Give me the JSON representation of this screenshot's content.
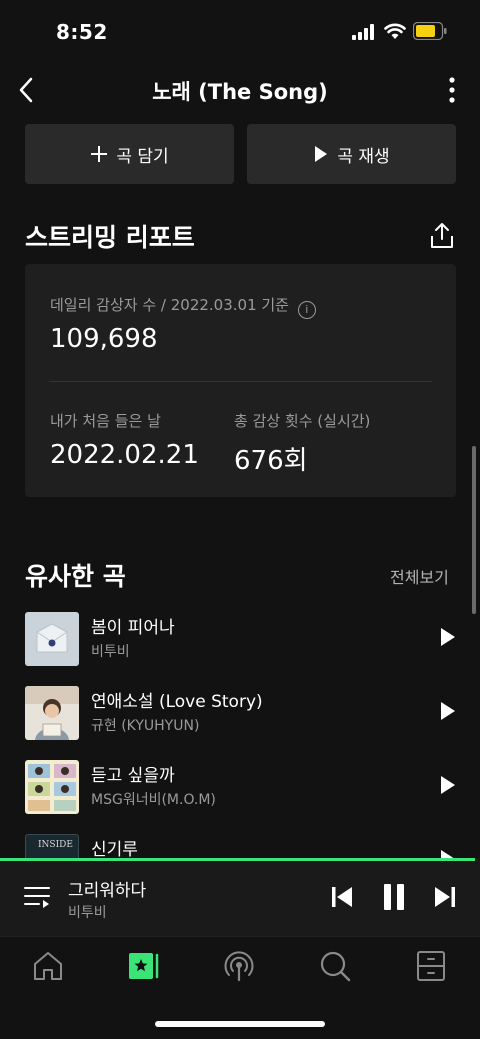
{
  "status": {
    "time": "8:52"
  },
  "header": {
    "title": "노래 (The Song)"
  },
  "actions": {
    "add_label": "곡 담기",
    "play_label": "곡 재생"
  },
  "report": {
    "title": "스트리밍 리포트",
    "daily_label": "데일리 감상자 수 / 2022.03.01 기준",
    "daily_value": "109,698",
    "first_heard_label": "내가 처음 들은 날",
    "first_heard_value": "2022.02.21",
    "total_plays_label": "총 감상 횟수 (실시간)",
    "total_plays_value": "676회"
  },
  "similar": {
    "title": "유사한 곡",
    "see_all": "전체보기",
    "songs": [
      {
        "name": "봄이 피어나",
        "artist": "비투비"
      },
      {
        "name": "연애소설 (Love Story)",
        "artist": "규현 (KYUHYUN)"
      },
      {
        "name": "듣고 싶을까",
        "artist": "MSG워너비(M.O.M)"
      },
      {
        "name": "신기루",
        "artist": "",
        "art_text": "INSIDE"
      }
    ]
  },
  "player": {
    "title": "그리워하다",
    "artist": "비투비",
    "progress": 0.99
  },
  "colors": {
    "accent": "#3be477",
    "background": "#121212",
    "card": "#1f1f1f"
  },
  "tabs": [
    "home-icon",
    "library-star-icon",
    "podcast-icon",
    "search-icon",
    "storage-icon"
  ]
}
